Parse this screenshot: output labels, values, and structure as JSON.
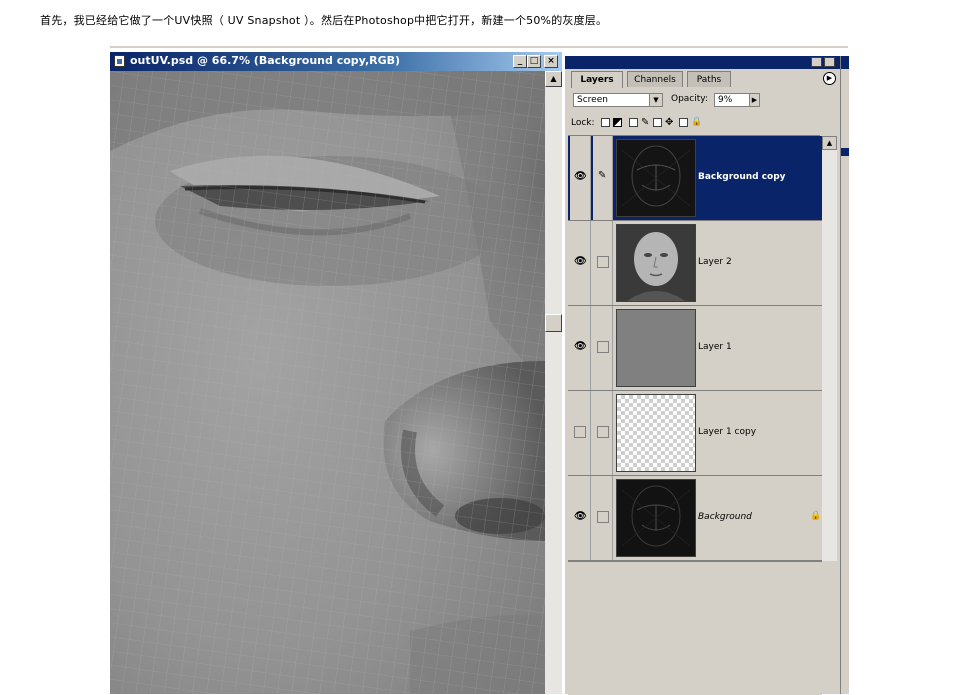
{
  "caption": "首先，我已经给它做了一个UV快照（ UV Snapshot ）。然后在Photoshop中把它打开，新建一个50%的灰度层。",
  "document_window": {
    "title": "outUV.psd @ 66.7% (Background copy,RGB)",
    "minimize_glyph": "_",
    "maximize_glyph": "□",
    "close_glyph": "×",
    "scroll_up_glyph": "▲"
  },
  "layers_palette": {
    "tabs": [
      {
        "label": "Layers",
        "active": true
      },
      {
        "label": "Channels",
        "active": false
      },
      {
        "label": "Paths",
        "active": false
      }
    ],
    "flyout_glyph": "▶",
    "blend_mode": "Screen",
    "dropdown_glyph": "▼",
    "opacity_label": "Opacity:",
    "opacity_value": "9%",
    "opacity_arrow": "▶",
    "lock_label": "Lock:",
    "lock_icons": {
      "brush": "✎",
      "move": "✥",
      "lock": "🔒"
    },
    "eye_glyph": "👁",
    "brush_glyph": "✎",
    "lock_badge": "🔒",
    "scroll_up_glyph": "▲",
    "layers": [
      {
        "name": "Background copy",
        "visible": true,
        "selected": true,
        "italic": false,
        "locked": false
      },
      {
        "name": "Layer 2",
        "visible": true,
        "selected": false,
        "italic": false,
        "locked": false
      },
      {
        "name": "Layer 1",
        "visible": true,
        "selected": false,
        "italic": false,
        "locked": false
      },
      {
        "name": "Layer 1 copy",
        "visible": false,
        "selected": false,
        "italic": false,
        "locked": false
      },
      {
        "name": "Background",
        "visible": true,
        "selected": false,
        "italic": true,
        "locked": true
      }
    ]
  },
  "colors": {
    "titlebar_active": "#0a246a",
    "selection": "#0a246a",
    "chrome": "#d4d0c8",
    "gray_layer": "#808080"
  }
}
